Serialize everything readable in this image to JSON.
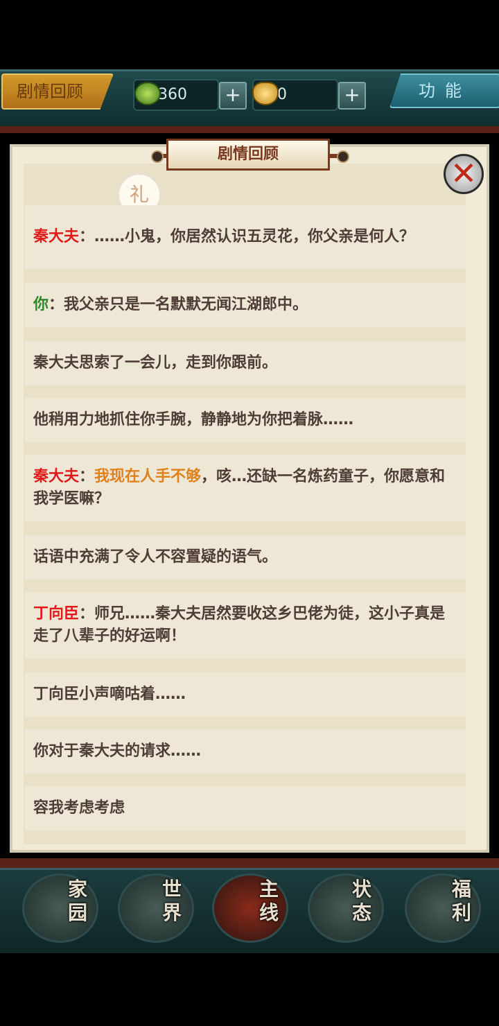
{
  "topbar": {
    "review_button": "剧情回顾",
    "jade_count": "360",
    "gold_count": "0",
    "plus_symbol": "+",
    "func_button": "功能",
    "jade_icon": "jade-coin-icon",
    "gold_icon": "gold-ingot-icon"
  },
  "panel": {
    "title": "剧情回顾",
    "close_symbol": "✕",
    "badge_text": "礼"
  },
  "dialog": {
    "r1": {
      "speaker": "秦大夫",
      "text": "：……小鬼，你居然认识五灵花，你父亲是何人？"
    },
    "r2": {
      "speaker": "你",
      "text": "：我父亲只是一名默默无闻江湖郎中。"
    },
    "r3": {
      "text": "秦大夫思索了一会儿，走到你跟前。"
    },
    "r4": {
      "text": "他稍用力地抓住你手腕，静静地为你把着脉……"
    },
    "r5": {
      "speaker": "秦大夫",
      "sep": "：",
      "highlight": "我现在人手不够",
      "text": "，咳…还缺一名炼药童子，你愿意和我学医嘛？"
    },
    "r6": {
      "text": "话语中充满了令人不容置疑的语气。"
    },
    "r7": {
      "speaker": "丁向臣",
      "text": "：师兄……秦大夫居然要收这乡巴佬为徒，这小子真是走了八辈子的好运啊！"
    },
    "r8": {
      "text": "丁向臣小声嘀咕着……"
    },
    "r9": {
      "text": "你对于秦大夫的请求……"
    },
    "r10": {
      "text": "容我考虑考虑"
    }
  },
  "nav": {
    "home": {
      "l1": "家",
      "l2": "园"
    },
    "world": {
      "l1": "世",
      "l2": "界"
    },
    "main": {
      "l1": "主",
      "l2": "线"
    },
    "status": {
      "l1": "状",
      "l2": "态"
    },
    "welfare": {
      "l1": "福",
      "l2": "利"
    }
  }
}
